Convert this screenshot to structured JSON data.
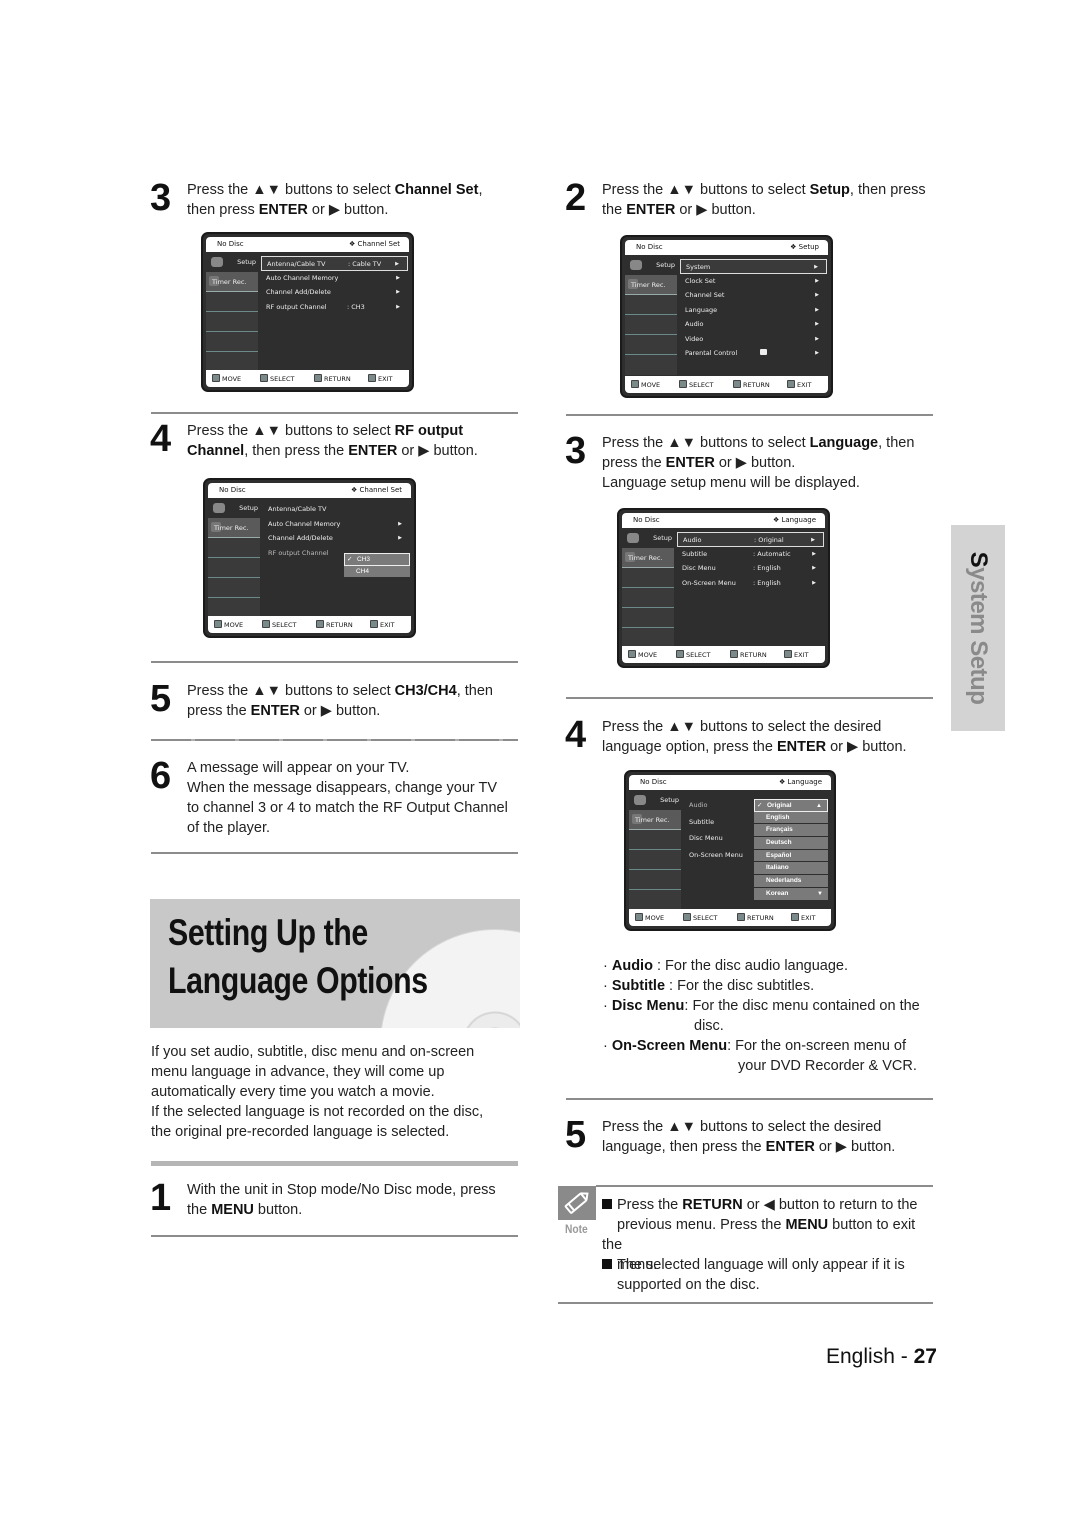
{
  "left_column": {
    "step3": {
      "number": "3",
      "pre": "Press the ▲▼ buttons to select ",
      "bold1": "Channel Set",
      "mid": ",",
      "line2_pre": "then press ",
      "bold2": "ENTER",
      "line2_post": " or ▶ button."
    },
    "screen_channel_set": {
      "header_left": "No Disc",
      "header_right": "❖ Channel Set",
      "side_setup": "Setup",
      "side_timer": "Timer Rec.",
      "items": [
        {
          "label": "Antenna/Cable TV",
          "value": ":  Cable TV",
          "arrow": "▶",
          "selected": true
        },
        {
          "label": "Auto Channel Memory",
          "value": "",
          "arrow": "▶",
          "selected": false
        },
        {
          "label": "Channel Add/Delete",
          "value": "",
          "arrow": "▶",
          "selected": false
        },
        {
          "label": "RF output Channel",
          "value": ":  CH3",
          "arrow": "▶",
          "selected": false
        }
      ],
      "footer": {
        "move": "MOVE",
        "select": "SELECT",
        "return": "RETURN",
        "exit": "EXIT"
      }
    },
    "step4": {
      "number": "4",
      "pre": "Press the ▲▼ buttons to select ",
      "bold1": "RF output",
      "bold2": "Channel",
      "mid": ", then press the ",
      "bold3": "ENTER",
      "post": " or ▶ button."
    },
    "screen_rf_output": {
      "header_left": "No Disc",
      "header_right": "❖ Channel Set",
      "side_setup": "Setup",
      "side_timer": "Timer Rec.",
      "items": [
        {
          "label": "Antenna/Cable TV",
          "arrow": ""
        },
        {
          "label": "Auto Channel Memory",
          "arrow": "▶"
        },
        {
          "label": "Channel Add/Delete",
          "arrow": "▶"
        },
        {
          "label": "RF output Channel",
          "arrow": ""
        }
      ],
      "options": [
        {
          "label": "CH3",
          "checked": true
        },
        {
          "label": "CH4",
          "checked": false
        }
      ],
      "check_mark": "✓",
      "footer": {
        "move": "MOVE",
        "select": "SELECT",
        "return": "RETURN",
        "exit": "EXIT"
      }
    },
    "step5": {
      "number": "5",
      "pre": "Press the ▲▼ buttons to select ",
      "bold1": "CH3/CH4",
      "mid": ", then",
      "line2_pre": "press the ",
      "bold2": "ENTER",
      "line2_post": " or ▶ button."
    },
    "step6": {
      "number": "6",
      "lines": [
        "A message will appear on your TV.",
        "When the message disappears, change your TV",
        "to channel 3 or 4 to match the RF Output Channel",
        "of the player."
      ]
    },
    "section_title_line1": "Setting Up the",
    "section_title_line2": "Language Options",
    "intro_lines": [
      "If you set audio, subtitle, disc menu and on-screen",
      "menu language in advance, they will come up",
      "automatically every time you watch a movie.",
      "If the selected language is not recorded on the disc,",
      "the original pre-recorded language is selected."
    ],
    "step1": {
      "number": "1",
      "line1": "With the unit in Stop mode/No Disc mode, press",
      "line2_pre": "the ",
      "bold": "MENU",
      "line2_post": " button."
    }
  },
  "right_column": {
    "step2": {
      "number": "2",
      "pre": "Press the ▲▼ buttons to select ",
      "bold1": "Setup",
      "mid": ", then press",
      "line2_pre": "the ",
      "bold2": "ENTER",
      "line2_post": " or ▶ button."
    },
    "screen_setup": {
      "header_left": "No Disc",
      "header_right": "❖ Setup",
      "side_setup": "Setup",
      "side_timer": "Timer Rec.",
      "items": [
        {
          "label": "System",
          "arrow": "▶",
          "selected": true
        },
        {
          "label": "Clock Set",
          "arrow": "▶"
        },
        {
          "label": "Channel Set",
          "arrow": "▶"
        },
        {
          "label": "Language",
          "arrow": "▶"
        },
        {
          "label": "Audio",
          "arrow": "▶"
        },
        {
          "label": "Video",
          "arrow": "▶"
        },
        {
          "label": "Parental Control",
          "arrow": "▶",
          "icon": "lock-icon"
        }
      ],
      "footer": {
        "move": "MOVE",
        "select": "SELECT",
        "return": "RETURN",
        "exit": "EXIT"
      }
    },
    "step3": {
      "number": "3",
      "pre": "Press the ▲▼ buttons to select ",
      "bold1": "Language",
      "mid": ", then",
      "line2_pre": "press the ",
      "bold2": "ENTER",
      "line2_post": " or ▶ button.",
      "line3": "Language setup menu will be displayed."
    },
    "screen_language": {
      "header_left": "No Disc",
      "header_right": "❖ Language",
      "side_setup": "Setup",
      "side_timer": "Timer Rec.",
      "items": [
        {
          "label": "Audio",
          "value": ": Original",
          "arrow": "▶",
          "selected": true
        },
        {
          "label": "Subtitle",
          "value": ": Automatic",
          "arrow": "▶"
        },
        {
          "label": "Disc Menu",
          "value": ": English",
          "arrow": "▶"
        },
        {
          "label": "On-Screen Menu",
          "value": ": English",
          "arrow": "▶"
        }
      ],
      "footer": {
        "move": "MOVE",
        "select": "SELECT",
        "return": "RETURN",
        "exit": "EXIT"
      }
    },
    "step4": {
      "number": "4",
      "line1": "Press the ▲▼ buttons to select the desired",
      "line2_pre": "language option, press the ",
      "bold": "ENTER",
      "line2_post": " or ▶ button."
    },
    "screen_language_options": {
      "header_left": "No Disc",
      "header_right": "❖ Language",
      "side_setup": "Setup",
      "side_timer": "Timer Rec.",
      "items": [
        "Audio",
        "Subtitle",
        "Disc Menu",
        "On-Screen Menu"
      ],
      "options": [
        "Original",
        "English",
        "Français",
        "Deutsch",
        "Español",
        "Italiano",
        "Nederlands",
        "Korean"
      ],
      "selected_option": "Original",
      "check_mark": "✓",
      "scroll_up": "▲",
      "scroll_down": "▼",
      "footer": {
        "move": "MOVE",
        "select": "SELECT",
        "return": "RETURN",
        "exit": "EXIT"
      }
    },
    "bullets": [
      {
        "term": "Audio",
        "sep": " : ",
        "desc": "For the disc audio language.",
        "cont": ""
      },
      {
        "term": "Subtitle",
        "sep": " : ",
        "desc": "For the disc subtitles.",
        "cont": ""
      },
      {
        "term": "Disc Menu",
        "sep": ": ",
        "desc": "For the disc menu contained on the",
        "cont": "disc."
      },
      {
        "term": "On-Screen Menu",
        "sep": ": ",
        "desc": "For the on-screen menu of",
        "cont": "your DVD Recorder & VCR."
      }
    ],
    "step5": {
      "number": "5",
      "line1": "Press the ▲▼ buttons to select the desired",
      "line2_pre": "language, then press the ",
      "bold": "ENTER",
      "line2_post": " or ▶ button."
    },
    "note": {
      "label": "Note",
      "item1": {
        "pre": "Press the ",
        "bold1": "RETURN",
        "mid1": " or ◀ button to return to the",
        "line2_pre": "previous menu. Press the ",
        "bold2": "MENU",
        "line2_post": " button to exit the",
        "line3": "menu."
      },
      "item2": {
        "line1": "The selected language will only appear if it is",
        "line2": "supported on the disc."
      }
    }
  },
  "side_tab": {
    "first_letter": "S",
    "rest": "ystem Setup"
  },
  "footer": {
    "language": "English",
    "separator": " - ",
    "page": "27"
  },
  "colors": {
    "screen_bg": "#2e2e2e",
    "banner_bg": "#c8c8c8",
    "side_tab_bg": "#d3d3d3",
    "rule": "#8c8c8c"
  }
}
